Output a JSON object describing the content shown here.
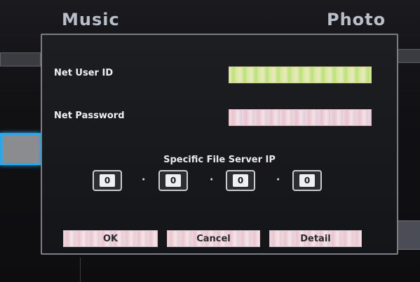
{
  "tabs": {
    "music": "Music",
    "photo": "Photo"
  },
  "dialog": {
    "user_id_label": "Net User ID",
    "password_label": "Net Password",
    "server_ip_label": "Specific File Server IP",
    "ip_octets": [
      "0",
      "0",
      "0",
      "0"
    ],
    "ip_separator": "·",
    "buttons": {
      "ok": "OK",
      "cancel": "Cancel",
      "detail": "Detail"
    }
  }
}
